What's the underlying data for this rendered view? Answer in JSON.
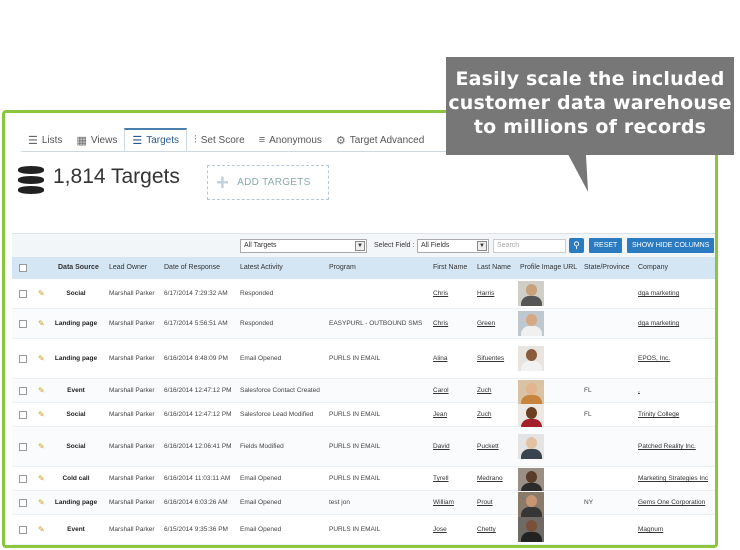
{
  "callout": {
    "line1": "Easily scale the included",
    "line2": "customer data warehouse",
    "line3": "to millions of records"
  },
  "tabs": [
    {
      "label": "Lists",
      "icon": "list-icon"
    },
    {
      "label": "Views",
      "icon": "views-icon"
    },
    {
      "label": "Targets",
      "icon": "targets-icon",
      "active": true
    },
    {
      "label": "Set Score",
      "icon": "sliders-icon"
    },
    {
      "label": "Anonymous",
      "icon": "anonymous-icon"
    },
    {
      "label": "Target Advanced",
      "icon": "gear-icon"
    }
  ],
  "header": {
    "count_title": "1,814 Targets",
    "add_targets_label": "ADD TARGETS"
  },
  "toolbar": {
    "view_select": "All Targets",
    "select_field_label": "Select Field :",
    "field_select": "All Fields",
    "search_placeholder": "Search",
    "reset_label": "RESET",
    "show_hide_label": "SHOW HIDE COLUMNS"
  },
  "columns": {
    "data_source": "Data Source",
    "lead_owner": "Lead Owner",
    "date_of_response": "Date of Response",
    "latest_activity": "Latest Activity",
    "program": "Program",
    "first_name": "First Name",
    "last_name": "Last Name",
    "profile_image_url": "Profile Image URL",
    "state_province": "State/Province",
    "company": "Company"
  },
  "rows": [
    {
      "source": "Social",
      "owner": "Marshall Parker",
      "date": "6/17/2014 7:29:32 AM",
      "activity": "Responded",
      "program": "",
      "first": "Chris",
      "last": "Harris",
      "state": "",
      "company": "dga marketing",
      "face": "#c8a07a",
      "shirt": "#555555",
      "bg": "#cfcfc7"
    },
    {
      "source": "Landing page",
      "owner": "Marshall Parker",
      "date": "6/17/2014 5:56:51 AM",
      "activity": "Responded",
      "program": "EASYPURL - OUTBOUND SMS",
      "first": "Chris",
      "last": "Green",
      "state": "",
      "company": "dga marketing",
      "face": "#d6a883",
      "shirt": "#f0f0f0",
      "bg": "#bfc7cf"
    },
    {
      "source": "Landing page",
      "owner": "Marshall Parker",
      "date": "6/16/2014 8:48:09 PM",
      "activity": "Email Opened",
      "program": "PURLS IN EMAIL",
      "first": "Alina",
      "last": "Sifuentes",
      "state": "",
      "company": "EPOS, Inc.",
      "face": "#8a5a3a",
      "shirt": "#f2f2f2",
      "bg": "#e8e4df"
    },
    {
      "source": "Event",
      "owner": "Marshall Parker",
      "date": "6/16/2014 12:47:12 PM",
      "activity": "Salesforce Contact Created",
      "program": "",
      "first": "Carol",
      "last": "Zuch",
      "state": "FL",
      "company": ",",
      "face": "#e2b48c",
      "shirt": "#c8843c",
      "bg": "#d9c3a5"
    },
    {
      "source": "Social",
      "owner": "Marshall Parker",
      "date": "6/16/2014 12:47:12 PM",
      "activity": "Salesforce Lead Modified",
      "program": "PURLS IN EMAIL",
      "first": "Jean",
      "last": "Zuch",
      "state": "FL",
      "company": "Trinity College",
      "face": "#6b3f24",
      "shirt": "#a51f2a",
      "bg": "#ece8e3"
    },
    {
      "source": "Social",
      "owner": "Marshall Parker",
      "date": "6/16/2014 12:06:41 PM",
      "activity": "Fields Modified",
      "program": "PURLS IN EMAIL",
      "first": "David",
      "last": "Puckett",
      "state": "",
      "company": "Patched Reality Inc.",
      "face": "#e3c2a4",
      "shirt": "#3a4350",
      "bg": "#e4e4e4"
    },
    {
      "source": "Cold call",
      "owner": "Marshall Parker",
      "date": "6/16/2014 11:03:11 AM",
      "activity": "Email Opened",
      "program": "PURLS IN EMAIL",
      "first": "Tyrell",
      "last": "Medrano",
      "state": "",
      "company": "Marketing Strategies Inc",
      "face": "#5a3a28",
      "shirt": "#2b2b2b",
      "bg": "#9a8f85"
    },
    {
      "source": "Landing page",
      "owner": "Marshall Parker",
      "date": "6/16/2014 6:03:26 AM",
      "activity": "Email Opened",
      "program": "test jon",
      "first": "William",
      "last": "Prout",
      "state": "NY",
      "company": "Gems One Corporation",
      "face": "#c79572",
      "shirt": "#363636",
      "bg": "#8a7a6a"
    },
    {
      "source": "Event",
      "owner": "Marshall Parker",
      "date": "6/15/2014 9:35:36 PM",
      "activity": "Email Opened",
      "program": "PURLS IN EMAIL",
      "first": "Jose",
      "last": "Chetty",
      "state": "",
      "company": "Magnum",
      "face": "#7a5038",
      "shirt": "#222222",
      "bg": "#6f6a66"
    }
  ]
}
